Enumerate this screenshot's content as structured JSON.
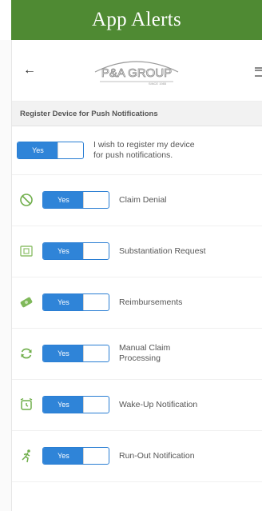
{
  "banner": {
    "title": "App Alerts"
  },
  "header": {
    "logo_text": "P&A GROUP",
    "logo_sub": "SINCE 1985",
    "back_icon": "arrow-left-icon",
    "menu_icon": "hamburger-menu-icon"
  },
  "section": {
    "title": "Register Device for Push Notifications"
  },
  "register": {
    "toggle_label": "Yes",
    "text_line1": "I wish to register my device",
    "text_line2": "for push notifications."
  },
  "alerts": [
    {
      "icon": "ban-icon",
      "toggle_label": "Yes",
      "label": "Claim Denial"
    },
    {
      "icon": "document-icon",
      "toggle_label": "Yes",
      "label": "Substantiation Request"
    },
    {
      "icon": "money-icon",
      "toggle_label": "Yes",
      "label": "Reimbursements"
    },
    {
      "icon": "refresh-icon",
      "toggle_label": "Yes",
      "label_line1": "Manual Claim",
      "label_line2": "Processing"
    },
    {
      "icon": "alarm-clock-icon",
      "toggle_label": "Yes",
      "label": "Wake-Up Notification"
    },
    {
      "icon": "runner-icon",
      "toggle_label": "Yes",
      "label": "Run-Out Notification"
    }
  ],
  "colors": {
    "banner": "#4f8a33",
    "toggle_on": "#2f84d8",
    "icon_green": "#6fae4a",
    "logo": "#8a8a8a"
  }
}
